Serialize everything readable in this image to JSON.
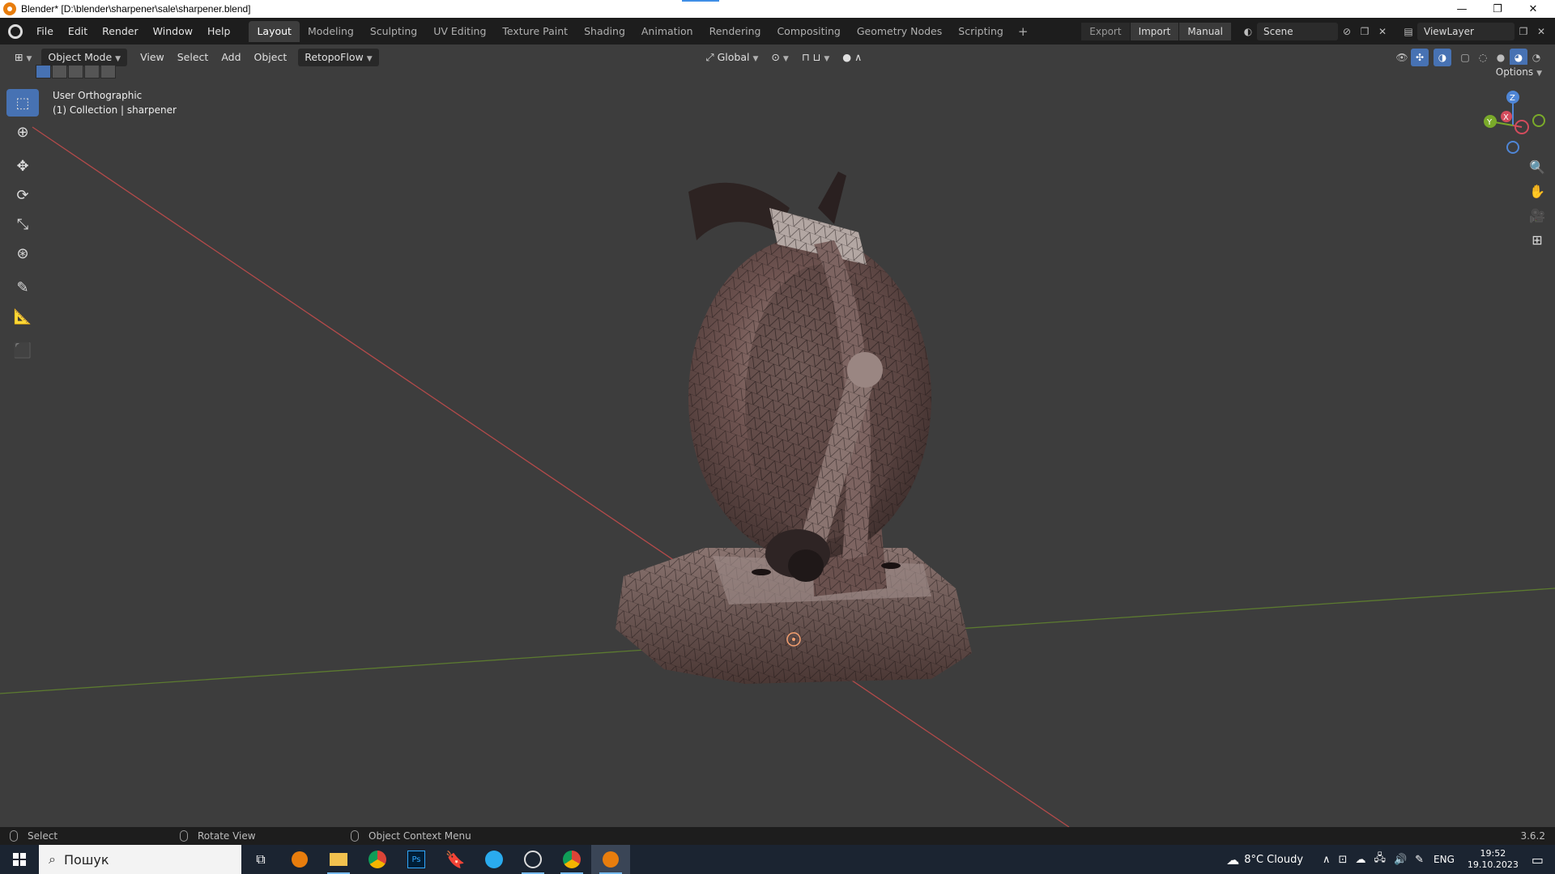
{
  "window": {
    "title": "Blender* [D:\\blender\\sharpener\\sale\\sharpener.blend]",
    "controls": [
      "—",
      "❐",
      "✕"
    ]
  },
  "menu": [
    "File",
    "Edit",
    "Render",
    "Window",
    "Help"
  ],
  "workspaces": [
    "Layout",
    "Modeling",
    "Sculpting",
    "UV Editing",
    "Texture Paint",
    "Shading",
    "Animation",
    "Rendering",
    "Compositing",
    "Geometry Nodes",
    "Scripting"
  ],
  "active_workspace": "Layout",
  "topright": {
    "export_label": "Export",
    "import_label": "Import",
    "manual_label": "Manual",
    "scene_name": "Scene",
    "viewlayer_name": "ViewLayer"
  },
  "header": {
    "mode": "Object Mode",
    "menus": [
      "View",
      "Select",
      "Add",
      "Object"
    ],
    "addon": "RetopoFlow",
    "orientation": "Global",
    "options_label": "Options"
  },
  "viewport": {
    "view_name": "User Orthographic",
    "collection_info": "(1) Collection | sharpener",
    "gizmo_axes": {
      "x": "X",
      "y": "Y",
      "z": "Z"
    }
  },
  "status": {
    "select": "Select",
    "rotate": "Rotate View",
    "context": "Object Context Menu",
    "version": "3.6.2"
  },
  "taskbar": {
    "search_placeholder": "Пошук",
    "weather": "8°C  Cloudy",
    "language": "ENG",
    "time": "19:52",
    "date": "19.10.2023"
  },
  "colors": {
    "accent": "#4772b3",
    "axis_x": "#d24a4a",
    "axis_y": "#6f9a3a",
    "blender_orange": "#e87d0d"
  }
}
